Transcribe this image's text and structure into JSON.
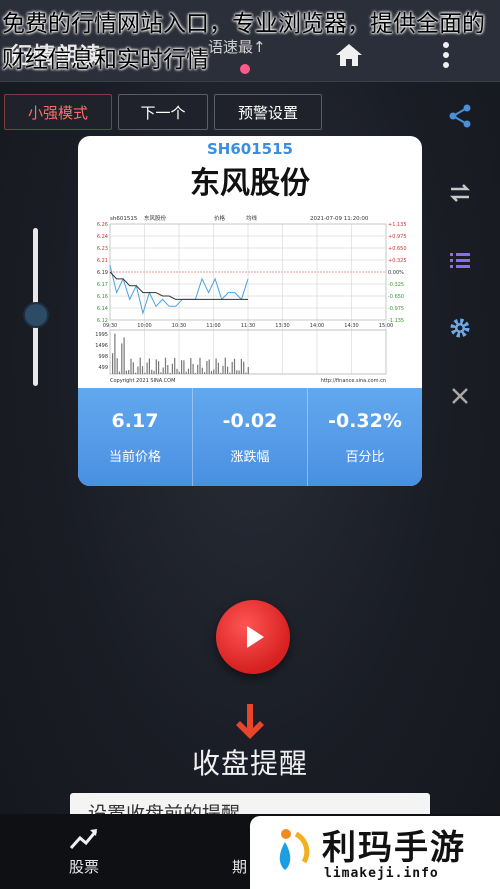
{
  "overlay_title": "免费的行情网站入口，专业浏览器，提供全面的财经信息和实时行情",
  "app": {
    "title": "行情朗读",
    "voice_label": "语速最↑"
  },
  "mode_buttons": [
    "小强模式",
    "下一个",
    "预警设置"
  ],
  "sidebar_icons": [
    "share-icon",
    "repeat-icon",
    "list-icon",
    "gear-icon",
    "close-icon"
  ],
  "slider": {
    "level_fraction": 0.45
  },
  "stock": {
    "code": "SH601515",
    "name": "东风股份",
    "price": "6.17",
    "change": "-0.02",
    "percent": "-0.32%",
    "price_label": "当前价格",
    "change_label": "涨跌幅",
    "percent_label": "百分比"
  },
  "chart_data": {
    "type": "line",
    "header": [
      "sh601515",
      "东风股份",
      "价格",
      "均线",
      "2021-07-09 11:20:00"
    ],
    "y_left_ticks": [
      "6.26",
      "6.24",
      "6.23",
      "6.21",
      "6.19",
      "6.17",
      "6.16",
      "6.14",
      "6.12"
    ],
    "y_right_ticks": [
      "+1.135",
      "+0.975",
      "+0.650",
      "+0.325",
      "0.00%",
      "-0.325",
      "-0.650",
      "-0.975",
      "-1.135"
    ],
    "x_ticks": [
      "09:30",
      "10:00",
      "10:30",
      "11:00",
      "11:30",
      "13:30",
      "14:00",
      "14:30",
      "15:00"
    ],
    "volume_ticks": [
      "1995",
      "1496",
      "998",
      "499"
    ],
    "footer_left": "Copyright 2021 SINA.COM",
    "footer_right": "http://finance.sina.com.cn",
    "ylim": [
      6.12,
      6.26
    ],
    "series": [
      {
        "name": "价格",
        "values": [
          6.2,
          6.16,
          6.18,
          6.15,
          6.17,
          6.13,
          6.16,
          6.14,
          6.15,
          6.14,
          6.14,
          6.15,
          6.15,
          6.15,
          6.18,
          6.16,
          6.18,
          6.15,
          6.16,
          6.16,
          6.15,
          6.18
        ]
      },
      {
        "name": "均线",
        "values": [
          6.19,
          6.18,
          6.18,
          6.17,
          6.17,
          6.16,
          6.16,
          6.16,
          6.155,
          6.155,
          6.15,
          6.15,
          6.15,
          6.15,
          6.15,
          6.15,
          6.15,
          6.15,
          6.15,
          6.15,
          6.15,
          6.15
        ]
      }
    ]
  },
  "play": {
    "icon": "play-icon"
  },
  "reminder": {
    "title": "收盘提醒",
    "input_value": "设置收盘前的提醒"
  },
  "bottom_nav": [
    {
      "label": "股票",
      "icon": "trend-up-icon"
    },
    {
      "label": "期",
      "icon": "chart-icon"
    }
  ],
  "watermark": {
    "name": "利玛手游",
    "url": "limakeji.info"
  },
  "colors": {
    "accent_blue": "#4a90e2",
    "price_line": "#4aa3df",
    "avg_line": "#333333",
    "play_red": "#e02a2a",
    "active_mode": "#ff6b6b"
  }
}
